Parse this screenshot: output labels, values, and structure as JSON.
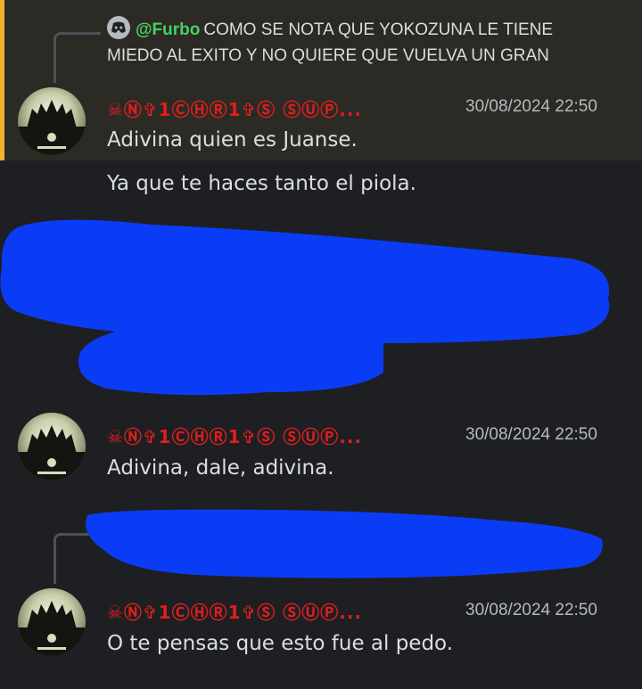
{
  "reply": {
    "mention": "@Furbo",
    "text": "COMO SE NOTA QUE YOKOZUNA LE TIENE MIEDO AL EXITO Y NO QUIERE QUE VUELVA UN GRAN"
  },
  "messages": [
    {
      "username": "☠Ⓝ✞1ⒸⒽⓇ1✞Ⓢ ⓈⓊⓅ...",
      "timestamp": "30/08/2024 22:50",
      "lines": [
        "Adivina quien es Juanse.",
        "Ya que te haces tanto el piola."
      ]
    },
    {
      "username": "☠Ⓝ✞1ⒸⒽⓇ1✞Ⓢ ⓈⓊⓅ...",
      "timestamp": "30/08/2024 22:50",
      "lines": [
        "Adivina, dale, adivina."
      ]
    },
    {
      "username": "☠Ⓝ✞1ⒸⒽⓇ1✞Ⓢ ⓈⓊⓅ...",
      "timestamp": "30/08/2024 22:50",
      "lines": [
        "O te pensas que esto fue al pedo."
      ]
    }
  ],
  "colors": {
    "background": "#1e1f22",
    "highlight": "#2c2a24",
    "highlight_bar": "#f0b232",
    "username": "#e01e1e",
    "mention": "#46d160",
    "redaction": "#0b3cf5"
  },
  "icons": [
    "discord-icon",
    "avatar"
  ]
}
